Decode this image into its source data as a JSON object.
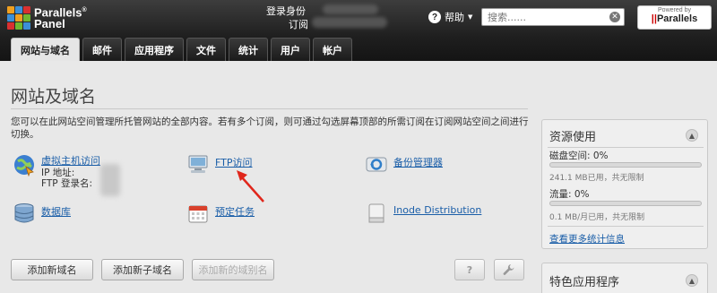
{
  "header": {
    "logo_line1": "Parallels",
    "logo_line2": "Panel",
    "login_identity_label": "登录身份",
    "subscription_label": "订阅",
    "help_label": "帮助",
    "search_placeholder": "搜索......",
    "powered_small": "Powered by",
    "powered_brand": "Parallels"
  },
  "tabs": [
    {
      "label": "网站与域名",
      "active": true
    },
    {
      "label": "邮件"
    },
    {
      "label": "应用程序"
    },
    {
      "label": "文件"
    },
    {
      "label": "统计"
    },
    {
      "label": "用户"
    },
    {
      "label": "帐户"
    }
  ],
  "main": {
    "title": "网站及域名",
    "description": "您可以在此网站空间管理所托管网站的全部内容。若有多个订阅，则可通过勾选屏幕顶部的所需订阅在订阅网站空间之间进行切换。",
    "tools": {
      "hosting_access": "虚拟主机访问",
      "ip_label": "IP 地址:",
      "ftp_login_label": "FTP 登录名:",
      "ftp_access": "FTP访问",
      "backup_manager": "备份管理器",
      "databases": "数据库",
      "scheduled_tasks": "预定任务",
      "inode_distribution": "Inode Distribution"
    },
    "buttons": {
      "add_domain": "添加新域名",
      "add_subdomain": "添加新子域名",
      "add_alias": "添加新的域别名",
      "help_icon": "?"
    }
  },
  "sidebar": {
    "resource_title": "资源使用",
    "disk_label": "磁盘空间: 0%",
    "disk_sub": "241.1 MB已用，共无限制",
    "traffic_label": "流量: 0%",
    "traffic_sub": "0.1 MB/月已用，共无限制",
    "more_link": "查看更多统计信息",
    "featured_title": "特色应用程序"
  },
  "colors": {
    "link": "#1a5ea8",
    "header_bg": "#1f1f1f",
    "arrow": "#e0261b"
  }
}
